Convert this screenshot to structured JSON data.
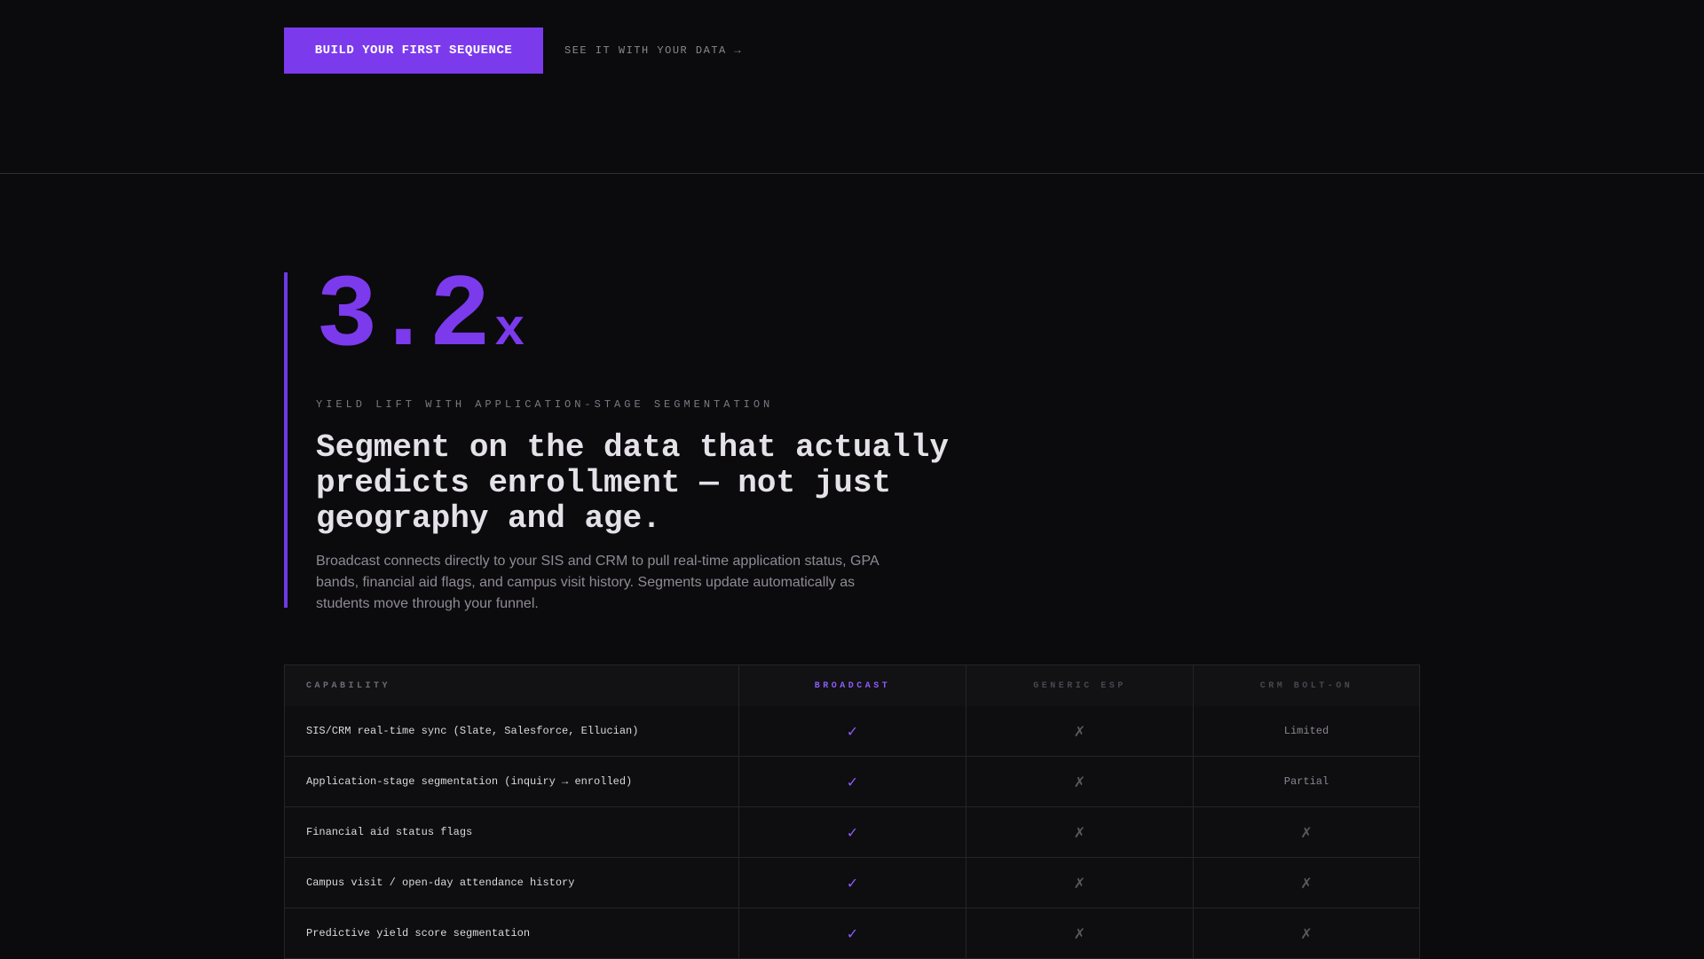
{
  "cta": {
    "primary_label": "BUILD YOUR FIRST SEQUENCE",
    "secondary_label": "SEE IT WITH YOUR DATA →"
  },
  "stat": {
    "value": "3.2",
    "suffix": "x",
    "label": "YIELD LIFT WITH APPLICATION-STAGE SEGMENTATION",
    "headline": "Segment on the data that actually predicts enrollment — not just geography and age.",
    "body": "Broadcast connects directly to your SIS and CRM to pull real-time application status, GPA bands, financial aid flags, and campus visit history. Segments update automatically as students move through your funnel."
  },
  "colors": {
    "accent": "#7c3aed",
    "background": "#0b0a0d"
  },
  "table": {
    "headers": [
      "CAPABILITY",
      "BROADCAST",
      "GENERIC ESP",
      "CRM BOLT-ON"
    ],
    "rows": [
      {
        "capability": "SIS/CRM real-time sync (Slate, Salesforce, Ellucian)",
        "broadcast": "✓",
        "generic": "✗",
        "crm": "Limited"
      },
      {
        "capability": "Application-stage segmentation (inquiry → enrolled)",
        "broadcast": "✓",
        "generic": "✗",
        "crm": "Partial"
      },
      {
        "capability": "Financial aid status flags",
        "broadcast": "✓",
        "generic": "✗",
        "crm": "✗"
      },
      {
        "capability": "Campus visit / open-day attendance history",
        "broadcast": "✓",
        "generic": "✗",
        "crm": "✗"
      },
      {
        "capability": "Predictive yield score segmentation",
        "broadcast": "✓",
        "generic": "✗",
        "crm": "✗"
      }
    ]
  }
}
